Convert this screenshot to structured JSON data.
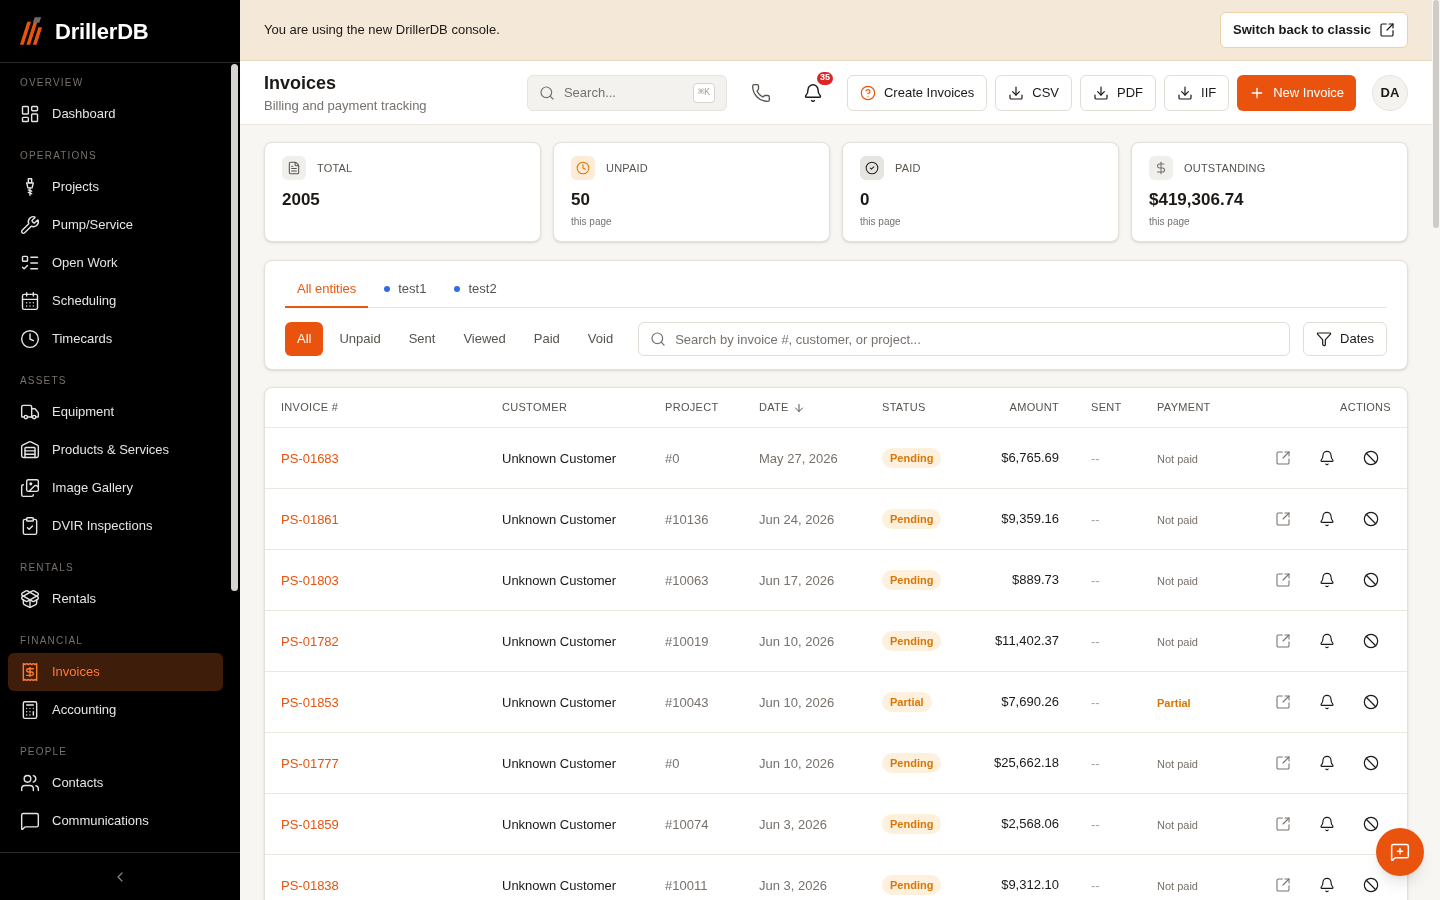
{
  "sidebar": {
    "brand": "DrillerDB",
    "sections": [
      {
        "label": "OVERVIEW",
        "items": [
          {
            "label": "Dashboard",
            "selected": false
          }
        ]
      },
      {
        "label": "OPERATIONS",
        "items": [
          {
            "label": "Projects",
            "selected": false
          },
          {
            "label": "Pump/Service",
            "selected": false
          },
          {
            "label": "Open Work",
            "selected": false
          },
          {
            "label": "Scheduling",
            "selected": false
          },
          {
            "label": "Timecards",
            "selected": false
          }
        ]
      },
      {
        "label": "ASSETS",
        "items": [
          {
            "label": "Equipment",
            "selected": false
          },
          {
            "label": "Products & Services",
            "selected": false
          },
          {
            "label": "Image Gallery",
            "selected": false
          },
          {
            "label": "DVIR Inspections",
            "selected": false
          }
        ]
      },
      {
        "label": "RENTALS",
        "items": [
          {
            "label": "Rentals",
            "selected": false
          }
        ]
      },
      {
        "label": "FINANCIAL",
        "items": [
          {
            "label": "Invoices",
            "selected": true
          },
          {
            "label": "Accounting",
            "selected": false
          }
        ]
      },
      {
        "label": "PEOPLE",
        "items": [
          {
            "label": "Contacts",
            "selected": false
          },
          {
            "label": "Communications",
            "selected": false
          }
        ]
      }
    ]
  },
  "banner": {
    "message": "You are using the new DrillerDB console.",
    "button": "Switch back to classic"
  },
  "header": {
    "title": "Invoices",
    "subtitle": "Billing and payment tracking",
    "search": {
      "placeholder": "Search...",
      "shortcut": "⌘K"
    },
    "notification_count": "35",
    "buttons": [
      {
        "label": "Create Invoices",
        "kind": "help"
      },
      {
        "label": "CSV",
        "kind": "download"
      },
      {
        "label": "PDF",
        "kind": "download"
      },
      {
        "label": "IIF",
        "kind": "download"
      },
      {
        "label": "New Invoice",
        "kind": "primary"
      }
    ],
    "avatar": "DA"
  },
  "stats": [
    {
      "kind": "total",
      "label": "TOTAL",
      "value": "2005"
    },
    {
      "kind": "unpaid",
      "label": "UNPAID",
      "value": "50",
      "note": "this page"
    },
    {
      "kind": "paid",
      "label": "PAID",
      "value": "0",
      "note": "this page"
    },
    {
      "kind": "outstanding",
      "label": "OUTSTANDING",
      "value": "$419,306.74",
      "note": "this page"
    }
  ],
  "entity_tabs": [
    {
      "label": "All entities",
      "selected": true
    },
    {
      "label": "test1",
      "selected": false,
      "color": "#2f6bea"
    },
    {
      "label": "test2",
      "selected": false,
      "color": "#2f6bea"
    }
  ],
  "status_filters": [
    {
      "label": "All",
      "selected": true
    },
    {
      "label": "Unpaid",
      "selected": false
    },
    {
      "label": "Sent",
      "selected": false
    },
    {
      "label": "Viewed",
      "selected": false
    },
    {
      "label": "Paid",
      "selected": false
    },
    {
      "label": "Void",
      "selected": false
    }
  ],
  "filter_search": {
    "placeholder": "Search by invoice #, customer, or project..."
  },
  "dates_button": "Dates",
  "table": {
    "columns": [
      {
        "label": "INVOICE #",
        "sorted": false
      },
      {
        "label": "CUSTOMER",
        "sorted": false
      },
      {
        "label": "PROJECT",
        "sorted": false
      },
      {
        "label": "DATE",
        "sorted": true
      },
      {
        "label": "STATUS",
        "sorted": false
      },
      {
        "label": "AMOUNT",
        "sorted": false
      },
      {
        "label": "SENT",
        "sorted": false
      },
      {
        "label": "PAYMENT",
        "sorted": false
      },
      {
        "label": "ACTIONS",
        "sorted": false
      }
    ],
    "rows": [
      {
        "invoice": "PS-01683",
        "customer": "Unknown Customer",
        "project": "#0",
        "date": "May 27, 2026",
        "status": "Pending",
        "amount": "$6,765.69",
        "sent": "--",
        "payment": {
          "label": "Not paid",
          "kind": "unpaid"
        }
      },
      {
        "invoice": "PS-01861",
        "customer": "Unknown Customer",
        "project": "#10136",
        "date": "Jun 24, 2026",
        "status": "Pending",
        "amount": "$9,359.16",
        "sent": "--",
        "payment": {
          "label": "Not paid",
          "kind": "unpaid"
        }
      },
      {
        "invoice": "PS-01803",
        "customer": "Unknown Customer",
        "project": "#10063",
        "date": "Jun 17, 2026",
        "status": "Pending",
        "amount": "$889.73",
        "sent": "--",
        "payment": {
          "label": "Not paid",
          "kind": "unpaid"
        }
      },
      {
        "invoice": "PS-01782",
        "customer": "Unknown Customer",
        "project": "#10019",
        "date": "Jun 10, 2026",
        "status": "Pending",
        "amount": "$11,402.37",
        "sent": "--",
        "payment": {
          "label": "Not paid",
          "kind": "unpaid"
        }
      },
      {
        "invoice": "PS-01853",
        "customer": "Unknown Customer",
        "project": "#10043",
        "date": "Jun 10, 2026",
        "status": "Partial",
        "amount": "$7,690.26",
        "sent": "--",
        "payment": {
          "label": "Partial",
          "kind": "partial"
        }
      },
      {
        "invoice": "PS-01777",
        "customer": "Unknown Customer",
        "project": "#0",
        "date": "Jun 10, 2026",
        "status": "Pending",
        "amount": "$25,662.18",
        "sent": "--",
        "payment": {
          "label": "Not paid",
          "kind": "unpaid"
        }
      },
      {
        "invoice": "PS-01859",
        "customer": "Unknown Customer",
        "project": "#10074",
        "date": "Jun 3, 2026",
        "status": "Pending",
        "amount": "$2,568.06",
        "sent": "--",
        "payment": {
          "label": "Not paid",
          "kind": "unpaid"
        }
      },
      {
        "invoice": "PS-01838",
        "customer": "Unknown Customer",
        "project": "#10011",
        "date": "Jun 3, 2026",
        "status": "Pending",
        "amount": "$9,312.10",
        "sent": "--",
        "payment": {
          "label": "Not paid",
          "kind": "unpaid"
        }
      }
    ]
  }
}
